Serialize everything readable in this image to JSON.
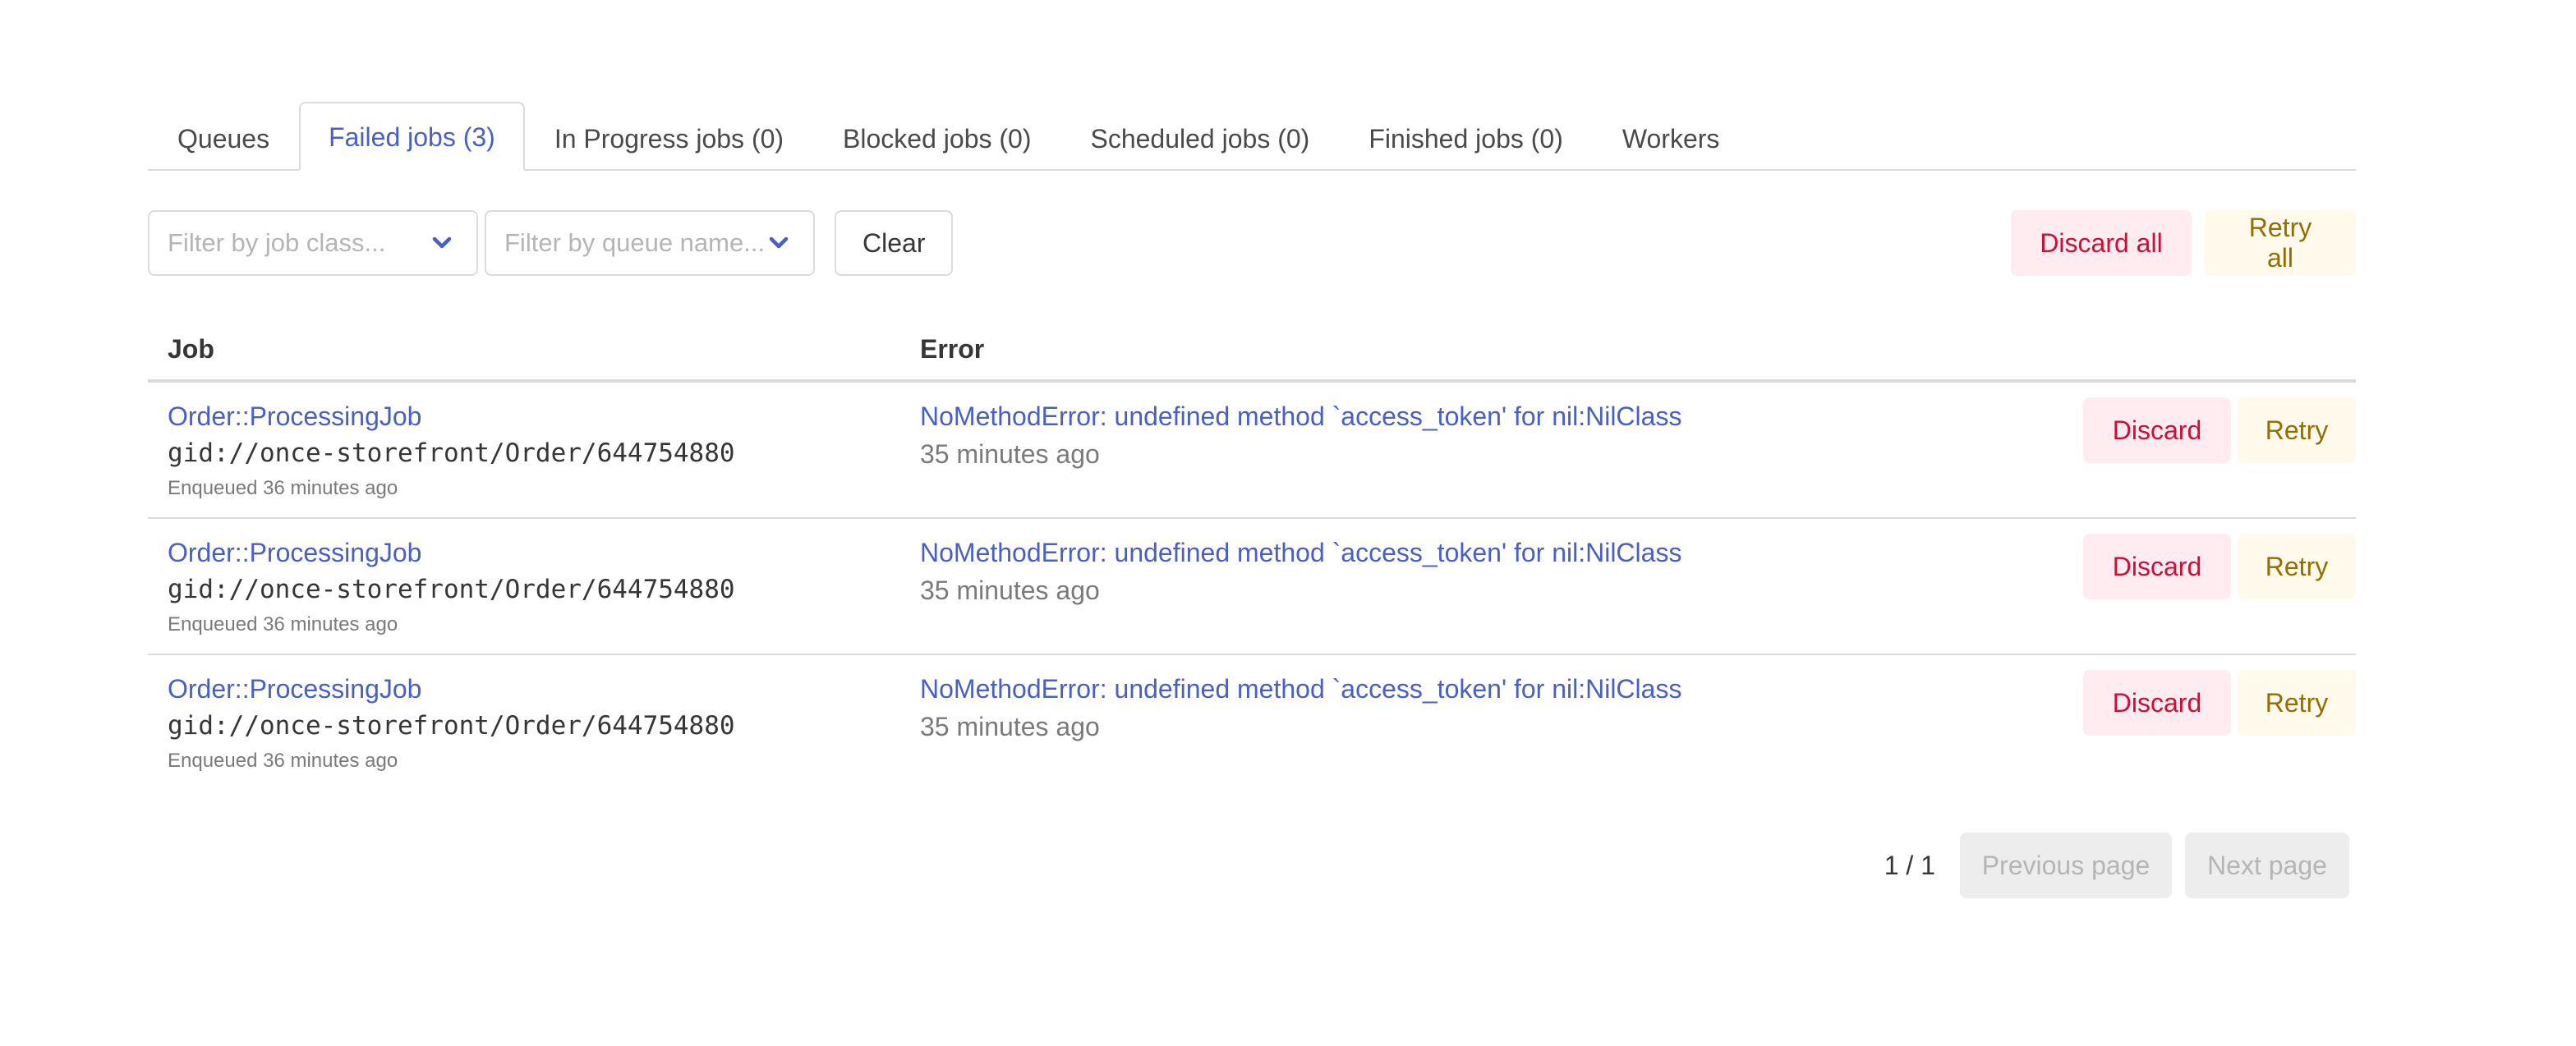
{
  "tabs": [
    {
      "label": "Queues",
      "active": false
    },
    {
      "label": "Failed jobs (3)",
      "active": true
    },
    {
      "label": "In Progress jobs (0)",
      "active": false
    },
    {
      "label": "Blocked jobs (0)",
      "active": false
    },
    {
      "label": "Scheduled jobs (0)",
      "active": false
    },
    {
      "label": "Finished jobs (0)",
      "active": false
    },
    {
      "label": "Workers",
      "active": false
    }
  ],
  "filters": {
    "job_class": {
      "placeholder": "Filter by job class...",
      "value": "",
      "icon": "chevron-down-icon"
    },
    "queue_name": {
      "placeholder": "Filter by queue name...",
      "value": "",
      "icon": "chevron-down-icon"
    },
    "clear_label": "Clear"
  },
  "bulk_actions": {
    "discard_all_label": "Discard all",
    "retry_all_label": "Retry all"
  },
  "table": {
    "columns": [
      "Job",
      "Error"
    ],
    "rows": [
      {
        "job_class": "Order::ProcessingJob",
        "argument": "gid://once-storefront/Order/644754880",
        "enqueued": "Enqueued 36 minutes ago",
        "error": "NoMethodError: undefined method `access_token' for nil:NilClass",
        "failed_at": "35 minutes ago",
        "discard_label": "Discard",
        "retry_label": "Retry"
      },
      {
        "job_class": "Order::ProcessingJob",
        "argument": "gid://once-storefront/Order/644754880",
        "enqueued": "Enqueued 36 minutes ago",
        "error": "NoMethodError: undefined method `access_token' for nil:NilClass",
        "failed_at": "35 minutes ago",
        "discard_label": "Discard",
        "retry_label": "Retry"
      },
      {
        "job_class": "Order::ProcessingJob",
        "argument": "gid://once-storefront/Order/644754880",
        "enqueued": "Enqueued 36 minutes ago",
        "error": "NoMethodError: undefined method `access_token' for nil:NilClass",
        "failed_at": "35 minutes ago",
        "discard_label": "Discard",
        "retry_label": "Retry"
      }
    ]
  },
  "pagination": {
    "page_info": "1 / 1",
    "previous_label": "Previous page",
    "next_label": "Next page",
    "previous_disabled": true,
    "next_disabled": true
  },
  "colors": {
    "link": "#485fc7",
    "danger_bg": "#feecf0",
    "danger_text": "#cc0f35",
    "warning_bg": "#fffaeb",
    "warning_text": "#946c00",
    "disabled_bg": "#ededed",
    "disabled_text": "#b5b5b5"
  }
}
